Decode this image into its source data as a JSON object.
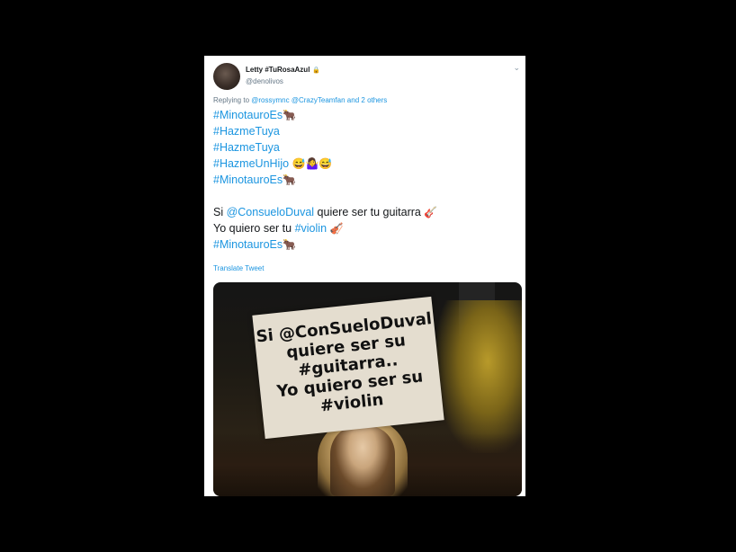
{
  "tweet": {
    "author_name": "Letty #TuRosaAzul",
    "lock_glyph": "🔒",
    "handle": "@denolivos",
    "reply_prefix": "Replying to",
    "reply_mention_1": "@rossymnc",
    "reply_mention_2": "@CrazyTeamfan",
    "reply_and": "and",
    "reply_others": "2 others",
    "lines": {
      "l1_tag": "#MinotauroEs",
      "l1_emoji": "🐂",
      "l2_tag": "#HazmeTuya",
      "l3_tag": "#HazmeTuya",
      "l4_tag": "#HazmeUnHijo",
      "l4_emoji": "😅🤷‍♀️😅",
      "l5_tag": "#MinotauroEs",
      "l5_emoji": "🐂",
      "l6_pre": "Si ",
      "l6_mention": "@ConsueloDuval",
      "l6_post": " quiere ser tu guitarra ",
      "l6_emoji": "🎸",
      "l7_pre": "Yo quiero ser tu ",
      "l7_tag": "#violin",
      "l7_emoji": "🎻",
      "l8_tag": "#MinotauroEs",
      "l8_emoji": "🐂"
    },
    "translate": "Translate Tweet",
    "chevron": "⌄"
  },
  "media": {
    "sign_lines": [
      "Si @ConSueloDuval",
      "quiere ser su",
      "#guitarra..",
      "Yo quiero ser su",
      "#violin"
    ]
  },
  "icons": {
    "avatar": "avatar",
    "lock": "lock-icon",
    "chevron": "chevron-down-icon"
  },
  "colors": {
    "link": "#1b95e0",
    "text": "#14171a",
    "muted": "#657786",
    "background": "#000000"
  }
}
